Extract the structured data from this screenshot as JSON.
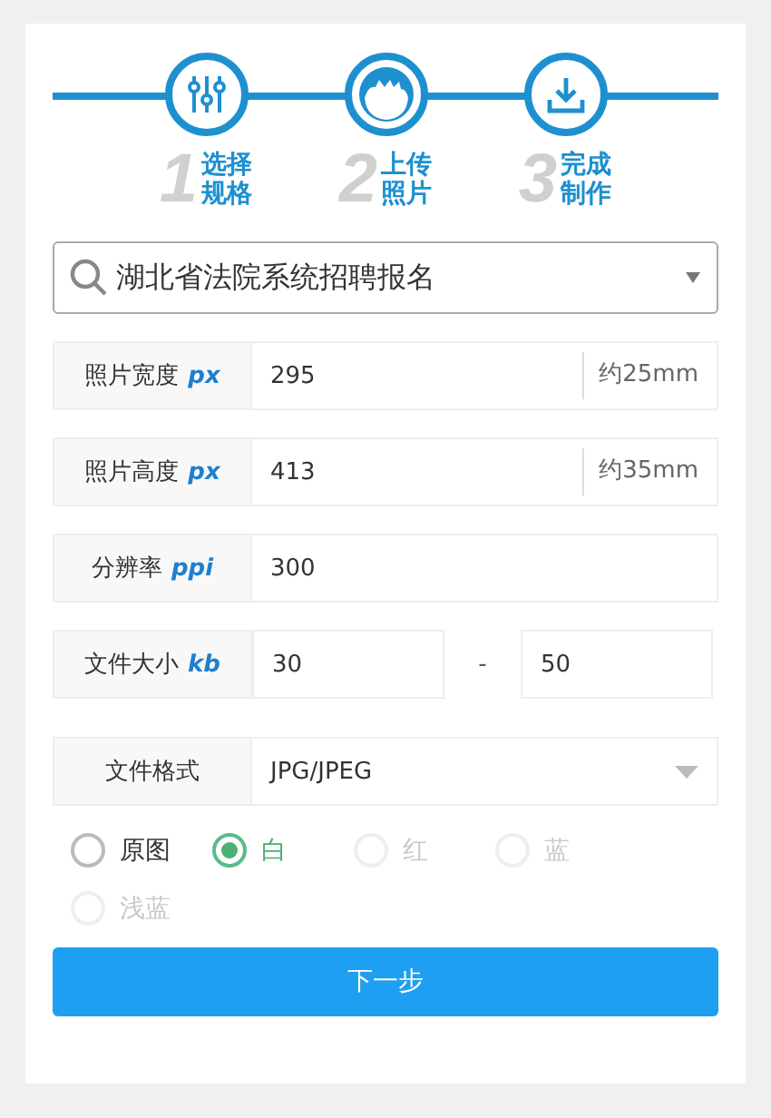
{
  "steps": [
    {
      "kind": "sliders",
      "number": "1",
      "lines": [
        "选择",
        "规格"
      ]
    },
    {
      "kind": "person",
      "number": "2",
      "lines": [
        "上传",
        "照片"
      ]
    },
    {
      "kind": "download",
      "number": "3",
      "lines": [
        "完成",
        "制作"
      ]
    }
  ],
  "template_select": {
    "value": "湖北省法院系统招聘报名"
  },
  "fields": [
    {
      "kind": "suffix",
      "label": "照片宽度",
      "unit": "px",
      "value": "295",
      "suffix": "约25mm"
    },
    {
      "kind": "suffix",
      "label": "照片高度",
      "unit": "px",
      "value": "413",
      "suffix": "约35mm"
    },
    {
      "kind": "plain",
      "label": "分辨率",
      "unit": "ppi",
      "value": "300"
    },
    {
      "kind": "range",
      "label": "文件大小",
      "unit": "kb",
      "value": "30",
      "separator": "-",
      "value2": "50"
    },
    {
      "kind": "select",
      "label": "文件格式",
      "value": "JPG/JPEG"
    }
  ],
  "backgrounds": [
    {
      "label": "原图",
      "selected": false,
      "disabled": false
    },
    {
      "label": "白",
      "selected": true,
      "disabled": false
    },
    {
      "label": "红",
      "selected": false,
      "disabled": true
    },
    {
      "label": "蓝",
      "selected": false,
      "disabled": true
    },
    {
      "label": "浅蓝",
      "selected": false,
      "disabled": true
    }
  ],
  "next_button": "下一步"
}
